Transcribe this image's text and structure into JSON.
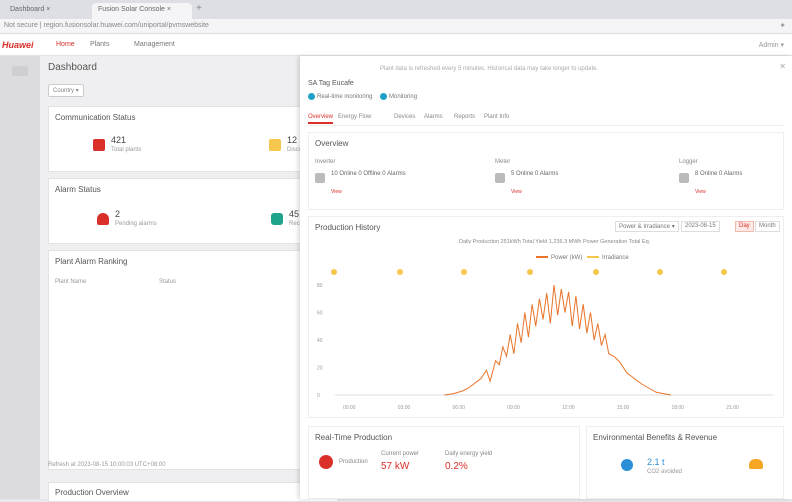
{
  "browser": {
    "tabs": [
      {
        "label": "Dashboard ×"
      },
      {
        "label": "Fusion Solar Console ×"
      }
    ],
    "url": "Not secure | region.fusionsolar.huawei.com/uniportal/pvmswebsite",
    "ext_icon": "shield"
  },
  "app": {
    "logo": "Huawei",
    "nav": [
      {
        "label": "Home"
      },
      {
        "label": "Plants"
      },
      {
        "label": "Management"
      }
    ],
    "right": "Admin ▾"
  },
  "dashboard": {
    "title": "Dashboard",
    "filter": "Country  ▾",
    "cards": {
      "communication": {
        "title": "Communication Status",
        "value1": "421",
        "sub1": "Total plants",
        "value2": "12",
        "sub2": "Disconnected"
      },
      "alarm": {
        "title": "Alarm Status",
        "value1": "2",
        "sub1": "Pending alarms",
        "value2": "45",
        "sub2": "Recovered"
      },
      "ranking": {
        "title": "Plant Alarm Ranking",
        "col1": "Plant Name",
        "col2": "Status"
      }
    },
    "footer_note": "Refresh at 2023-08-15 10:00:03 UTC+08:00",
    "production_overview": "Production Overview"
  },
  "panel": {
    "note": "Plant data is refreshed every 5 minutes. Historical data may take longer to update.",
    "plant_name": "SA Tag Eucafe",
    "options": [
      "Real-time monitoring",
      "Monitoring"
    ],
    "tabs": [
      "Overview",
      "Energy Flow",
      "Devices",
      "Alarms",
      "Reports",
      "Plant Info"
    ],
    "overview": {
      "title": "Overview",
      "groups": [
        {
          "label": "Inverter",
          "stats": [
            "10 Online",
            "0 Offline",
            "0 Alarms"
          ],
          "red": "View"
        },
        {
          "label": "Meter",
          "stats": [
            "5 Online",
            "0 Alarms"
          ],
          "red": "View"
        },
        {
          "label": "Logger",
          "stats": [
            "8 Online",
            "0 Alarms"
          ],
          "red": "View"
        }
      ]
    },
    "production_history": {
      "title": "Production History",
      "metrics": "Daily Production  251kWh  Total Yield  1,236.3 MWh  Power Generation  Total Eq.",
      "controls": [
        "Power & Irradiance ▾",
        "2023-08-15",
        "Day",
        "Month"
      ],
      "legend": [
        "Power (kW)",
        "Irradiance"
      ],
      "xlabels": [
        "00:00",
        "03:00",
        "06:00",
        "09:00",
        "12:00",
        "15:00",
        "18:00",
        "21:00"
      ],
      "ylabels": [
        "80",
        "60",
        "40",
        "20",
        "0"
      ]
    },
    "realtime": {
      "title": "Real-Time Production",
      "label": "Production",
      "current_power_label": "Current power",
      "current_power": "57 kW",
      "today_label": "Daily energy yield",
      "today_value": "0.2%"
    },
    "environment": {
      "title": "Environmental Benefits & Revenue",
      "value": "2.1 t",
      "sub": "CO2 avoided"
    }
  },
  "chart_data": {
    "type": "line",
    "series": [
      {
        "name": "Power (kW)",
        "color": "#e8742a",
        "x": [
          6,
          6.5,
          7,
          7.3,
          7.6,
          8,
          8.3,
          8.5,
          8.8,
          9,
          9.2,
          9.4,
          9.6,
          9.8,
          10,
          10.2,
          10.4,
          10.6,
          10.8,
          11,
          11.2,
          11.4,
          11.6,
          11.8,
          12,
          12.2,
          12.4,
          12.6,
          12.8,
          13,
          13.2,
          13.4,
          13.6,
          13.8,
          14,
          14.2,
          14.4,
          14.6,
          14.8,
          15,
          15.3,
          15.6,
          16,
          16.4,
          16.8,
          17.2,
          17.6,
          18,
          18.4
        ],
        "y": [
          0,
          1,
          3,
          5,
          8,
          12,
          18,
          10,
          25,
          22,
          35,
          28,
          44,
          30,
          52,
          38,
          60,
          42,
          66,
          50,
          70,
          55,
          74,
          52,
          80,
          58,
          77,
          60,
          75,
          50,
          72,
          48,
          66,
          45,
          60,
          40,
          52,
          36,
          44,
          30,
          28,
          24,
          16,
          12,
          8,
          5,
          2,
          1,
          0
        ]
      },
      {
        "name": "Irradiance",
        "color": "#f5c74d",
        "x": [],
        "y": []
      }
    ],
    "xlim": [
      0,
      24
    ],
    "ylim": [
      0,
      80
    ],
    "grid": false,
    "legend": "top-center"
  }
}
